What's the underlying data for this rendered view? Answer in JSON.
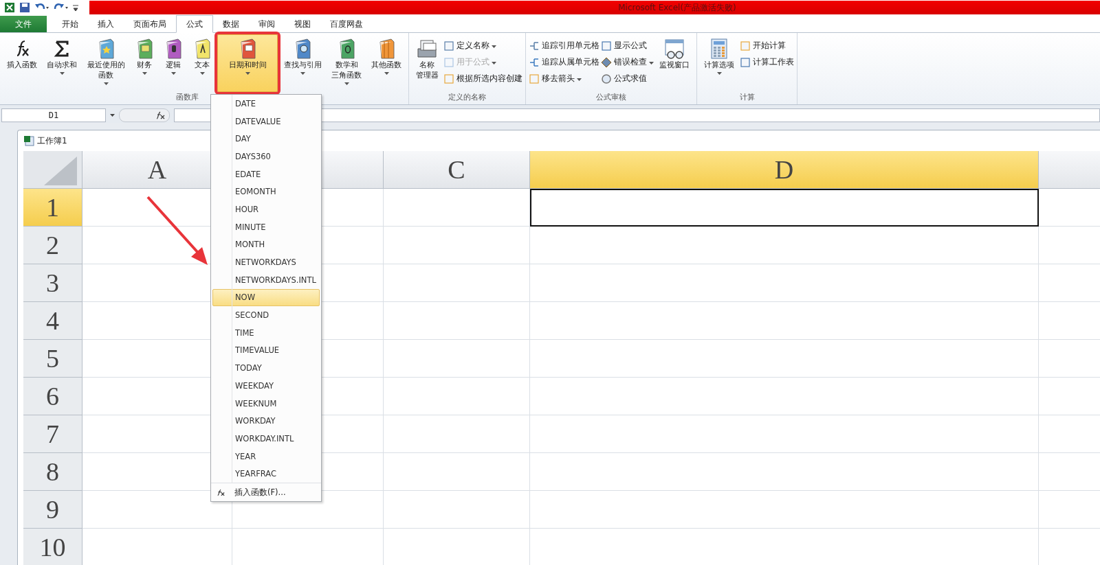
{
  "window": {
    "title": "Microsoft Excel(产品激活失败)"
  },
  "tabs": [
    {
      "label": "文件",
      "selected": false,
      "kind": "file"
    },
    {
      "label": "开始",
      "selected": false,
      "kind": "tab"
    },
    {
      "label": "插入",
      "selected": false,
      "kind": "tab"
    },
    {
      "label": "页面布局",
      "selected": false,
      "kind": "tab"
    },
    {
      "label": "公式",
      "selected": true,
      "kind": "tab"
    },
    {
      "label": "数据",
      "selected": false,
      "kind": "tab"
    },
    {
      "label": "审阅",
      "selected": false,
      "kind": "tab"
    },
    {
      "label": "视图",
      "selected": false,
      "kind": "tab"
    },
    {
      "label": "百度网盘",
      "selected": false,
      "kind": "tab"
    }
  ],
  "ribbon_groups": [
    {
      "title": "函数库",
      "items": [
        {
          "kind": "large",
          "label": "插入函数",
          "menu": false,
          "pressed": false
        },
        {
          "kind": "large",
          "label": "自动求和",
          "menu": true,
          "pressed": false
        },
        {
          "kind": "large",
          "lines": [
            "最近使用的",
            "函数"
          ],
          "menu": true,
          "pressed": false
        },
        {
          "kind": "large",
          "label": "财务",
          "menu": true,
          "pressed": false
        },
        {
          "kind": "large",
          "label": "逻辑",
          "menu": true,
          "pressed": false
        },
        {
          "kind": "large",
          "label": "文本",
          "menu": true,
          "pressed": false
        },
        {
          "kind": "large",
          "label": "日期和时间",
          "menu": true,
          "pressed": true
        },
        {
          "kind": "large",
          "label": "查找与引用",
          "menu": true,
          "pressed": false
        },
        {
          "kind": "large",
          "lines": [
            "数学和",
            "三角函数"
          ],
          "menu": true,
          "pressed": false
        },
        {
          "kind": "large",
          "label": "其他函数",
          "menu": true,
          "pressed": false
        }
      ]
    },
    {
      "title": "定义的名称",
      "items": [
        {
          "kind": "large",
          "lines": [
            "名称",
            "管理器"
          ],
          "menu": false,
          "disabled": false
        },
        {
          "kind": "small",
          "label": "定义名称",
          "menu": true,
          "disabled": false
        },
        {
          "kind": "small",
          "label": "用于公式",
          "menu": true,
          "disabled": true
        },
        {
          "kind": "small",
          "label": "根据所选内容创建",
          "menu": false,
          "disabled": false
        }
      ]
    },
    {
      "title": "公式审核",
      "items": [
        {
          "kind": "small",
          "label": "追踪引用单元格",
          "menu": false,
          "disabled": false
        },
        {
          "kind": "small",
          "label": "追踪从属单元格",
          "menu": false,
          "disabled": false
        },
        {
          "kind": "small",
          "label": "移去箭头",
          "menu": true,
          "disabled": false
        },
        {
          "kind": "small",
          "label": "显示公式",
          "menu": false,
          "disabled": false
        },
        {
          "kind": "small",
          "label": "错误检查",
          "menu": true,
          "disabled": false
        },
        {
          "kind": "small",
          "label": "公式求值",
          "menu": false,
          "disabled": false
        },
        {
          "kind": "large",
          "label": "监视窗口",
          "menu": false,
          "disabled": false
        }
      ]
    },
    {
      "title": "计算",
      "items": [
        {
          "kind": "large",
          "label": "计算选项",
          "menu": true,
          "disabled": false
        },
        {
          "kind": "small",
          "label": "开始计算",
          "menu": false,
          "disabled": false
        },
        {
          "kind": "small",
          "label": "计算工作表",
          "menu": false,
          "disabled": false
        }
      ]
    }
  ],
  "formula_bar": {
    "name_box": "D1"
  },
  "workbook": {
    "title": "工作簿1"
  },
  "sheet": {
    "columns": [
      {
        "label": "A",
        "selected": false
      },
      {
        "selected": false
      },
      {
        "label": "C",
        "selected": false
      },
      {
        "label": "D",
        "selected": true
      }
    ],
    "rows": [
      {
        "label": "1",
        "selected": true
      },
      {
        "label": "2",
        "selected": false
      },
      {
        "label": "3",
        "selected": false
      },
      {
        "label": "4",
        "selected": false
      },
      {
        "label": "5",
        "selected": false
      },
      {
        "label": "6",
        "selected": false
      },
      {
        "label": "7",
        "selected": false
      },
      {
        "label": "8",
        "selected": false
      },
      {
        "label": "9",
        "selected": false
      },
      {
        "label": "10",
        "selected": false
      }
    ]
  },
  "dropdown": {
    "items": [
      {
        "label": "DATE",
        "selected": false
      },
      {
        "label": "DATEVALUE",
        "selected": false
      },
      {
        "label": "DAY",
        "selected": false
      },
      {
        "label": "DAYS360",
        "selected": false
      },
      {
        "label": "EDATE",
        "selected": false
      },
      {
        "label": "EOMONTH",
        "selected": false
      },
      {
        "label": "HOUR",
        "selected": false
      },
      {
        "label": "MINUTE",
        "selected": false
      },
      {
        "label": "MONTH",
        "selected": false
      },
      {
        "label": "NETWORKDAYS",
        "selected": false
      },
      {
        "label": "NETWORKDAYS.INTL",
        "selected": false
      },
      {
        "label": "NOW",
        "selected": true
      },
      {
        "label": "SECOND",
        "selected": false
      },
      {
        "label": "TIME",
        "selected": false
      },
      {
        "label": "TIMEVALUE",
        "selected": false
      },
      {
        "label": "TODAY",
        "selected": false
      },
      {
        "label": "WEEKDAY",
        "selected": false
      },
      {
        "label": "WEEKNUM",
        "selected": false
      },
      {
        "label": "WORKDAY",
        "selected": false
      },
      {
        "label": "WORKDAY.INTL",
        "selected": false
      },
      {
        "label": "YEAR",
        "selected": false
      },
      {
        "label": "YEARFRAC",
        "selected": false
      }
    ],
    "footer": "插入函数(F)..."
  }
}
